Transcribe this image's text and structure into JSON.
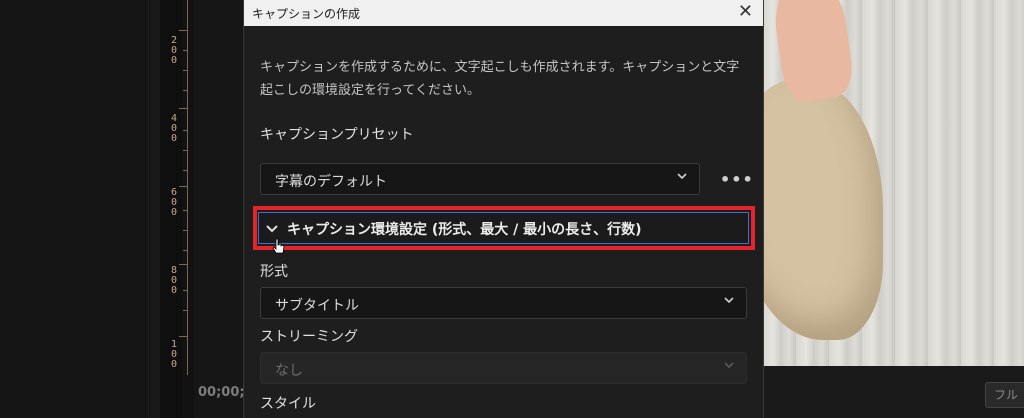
{
  "ruler": {
    "labels": [
      "200",
      "400",
      "600",
      "800",
      "100"
    ]
  },
  "timecode": "00;00;",
  "dialog": {
    "title": "キャプションの作成",
    "close_glyph": "✕",
    "description": "キャプションを作成するために、文字起こしも作成されます。キャプションと文字起こしの環境設定を行ってください。",
    "preset_label": "キャプションプリセット",
    "preset_value": "字幕のデフォルト",
    "more_glyph": "•••",
    "section_title": "キャプション環境設定 (形式、最大 / 最小の長さ、行数)",
    "format_label": "形式",
    "format_value": "サブタイトル",
    "streaming_label": "ストリーミング",
    "streaming_value": "なし",
    "style_label": "スタイル"
  },
  "video_controls": {
    "full_button": "フル"
  },
  "colors": {
    "highlight": "#e3242b",
    "focus": "#3d6fd1",
    "dialog_bg": "#1e1e1e"
  },
  "icons": [
    "close-icon",
    "chevron-down-icon",
    "more-icon",
    "mouse-cursor-icon"
  ]
}
